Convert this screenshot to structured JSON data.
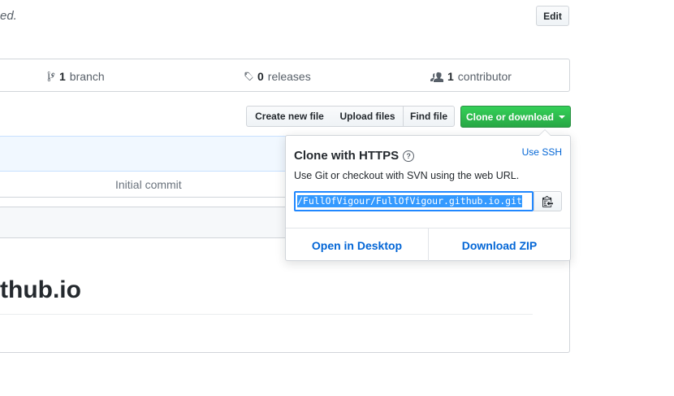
{
  "repo": {
    "description_fragment": "ed."
  },
  "edit_label": "Edit",
  "summary": {
    "branch_count": "1",
    "branch_label": "branch",
    "release_count": "0",
    "release_label": "releases",
    "contributor_count": "1",
    "contributor_label": "contributor"
  },
  "toolbar": {
    "create_file": "Create new file",
    "upload_files": "Upload files",
    "find_file": "Find file",
    "clone_download": "Clone or download"
  },
  "file_list": {
    "commit_message": "Initial commit"
  },
  "readme": {
    "title_fragment": "thub.io"
  },
  "clone_popover": {
    "title": "Clone with HTTPS",
    "help_glyph": "?",
    "use_ssh": "Use SSH",
    "description": "Use Git or checkout with SVN using the web URL.",
    "url_visible": "/FullOfVigour/FullOfVigour.github.io.git",
    "open_desktop": "Open in Desktop",
    "download_zip": "Download ZIP"
  },
  "colors": {
    "clone_button": "#28a745",
    "link": "#0366d6",
    "selection": "#3399ff"
  },
  "icons": {
    "branch": "git-branch-icon",
    "tag": "tag-icon",
    "people": "organization-icon",
    "help": "question-icon",
    "clipboard": "clippy-icon"
  }
}
